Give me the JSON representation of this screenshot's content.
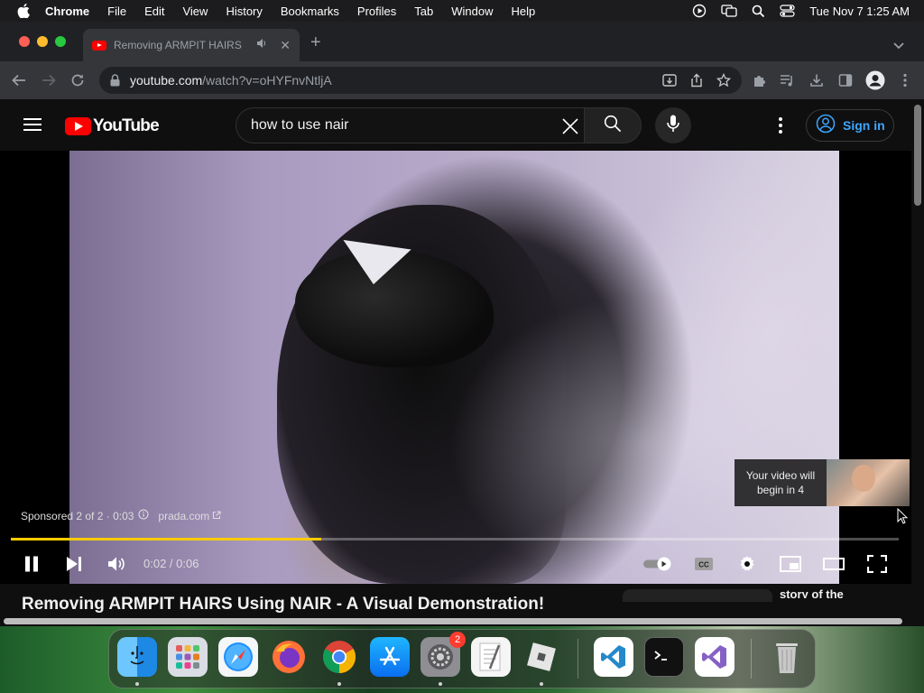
{
  "menubar": {
    "app": "Chrome",
    "items": [
      "File",
      "Edit",
      "View",
      "History",
      "Bookmarks",
      "Profiles",
      "Tab",
      "Window",
      "Help"
    ],
    "datetime": "Tue Nov 7  1:25 AM"
  },
  "browser": {
    "tab_title": "Removing ARMPIT HAIRS",
    "close_glyph": "✕",
    "new_tab_glyph": "+",
    "url_host": "youtube.com",
    "url_path": "/watch?v=oHYFnvNtljA"
  },
  "youtube": {
    "logo_text": "YouTube",
    "search_query": "how to use nair",
    "signin_label": "Sign in",
    "sponsored_text": "Sponsored 2 of 2 · 0:03",
    "advertiser": "prada.com",
    "upnext_text": "Your video will begin in 4",
    "time_display": "0:02 / 0:06",
    "progress_fraction": 0.35,
    "video_title": "Removing ARMPIT HAIRS Using NAIR - A Visual Demonstration!",
    "related_title_fragment": "story of the"
  },
  "dock": {
    "apps": [
      "finder-icon",
      "launchpad-icon",
      "safari-icon",
      "firefox-icon",
      "chrome-icon",
      "app-store-icon",
      "system-settings-icon",
      "textedit-icon",
      "roblox-icon",
      "vscode-icon",
      "terminal-icon",
      "visual-studio-icon",
      "trash-icon"
    ],
    "settings_badge": "2"
  },
  "colors": {
    "progress": "#ffcc00",
    "youtube_red": "#ff0000",
    "link_blue": "#3ea6ff"
  }
}
